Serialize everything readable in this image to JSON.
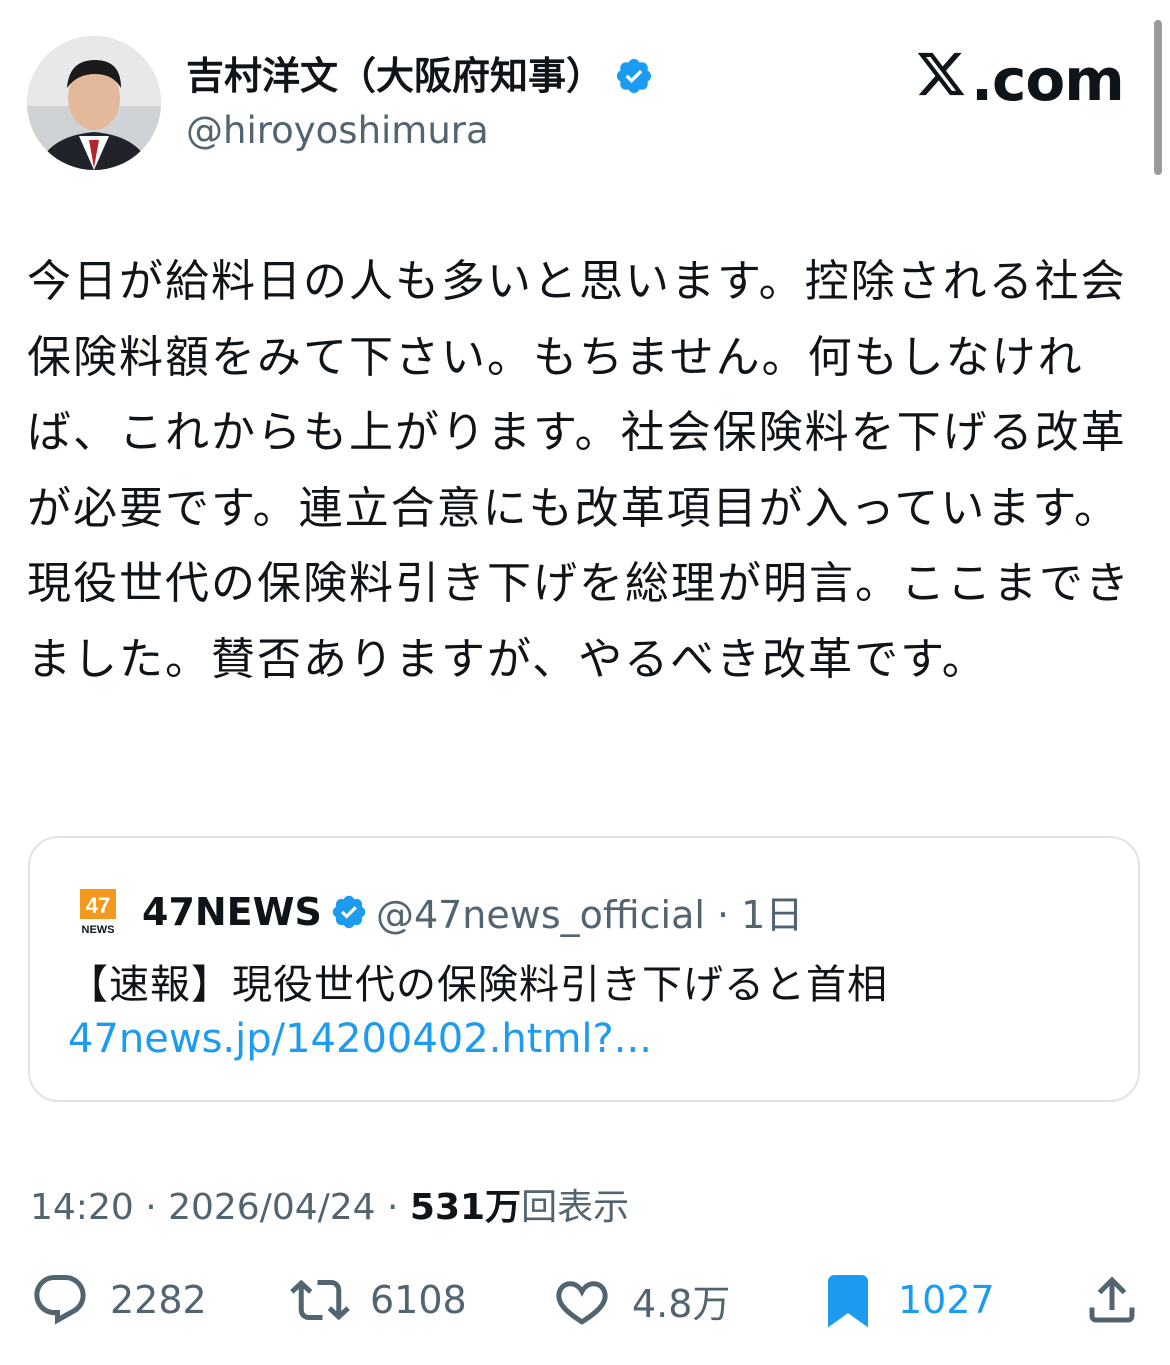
{
  "author": {
    "display_name": "吉村洋文（大阪府知事）",
    "handle": "@hiroyoshimura"
  },
  "watermark": "X.com",
  "watermark_rest": ".com",
  "tweet": {
    "text": "今日が給料日の人も多いと思います。控除される社会保険料額をみて下さい。もちません。何もしなければ、これからも上がります。社会保険料を下げる改革が必要です。連立合意にも改革項目が入っています。現役世代の保険料引き下げを総理が明言。ここまできました。賛否ありますが、やるべき改革です。"
  },
  "quote": {
    "logo_text": "47",
    "logo_sub": "NEWS",
    "name": "47NEWS",
    "handle_time": "@47news_official · 1日",
    "text": "【速報】現役世代の保険料引き下げると首相",
    "link": "47news.jp/14200402.html?..."
  },
  "meta": {
    "time_date": "14:20 · 2026/04/24 · ",
    "views_number": "531万",
    "views_label": "回表示"
  },
  "actions": {
    "replies": "2282",
    "reposts": "6108",
    "likes": "4.8万",
    "bookmarks": "1027"
  },
  "colors": {
    "accent": "#1d9bf0",
    "text": "#0f1419",
    "secondary": "#536471",
    "border": "#dfe3e6"
  }
}
